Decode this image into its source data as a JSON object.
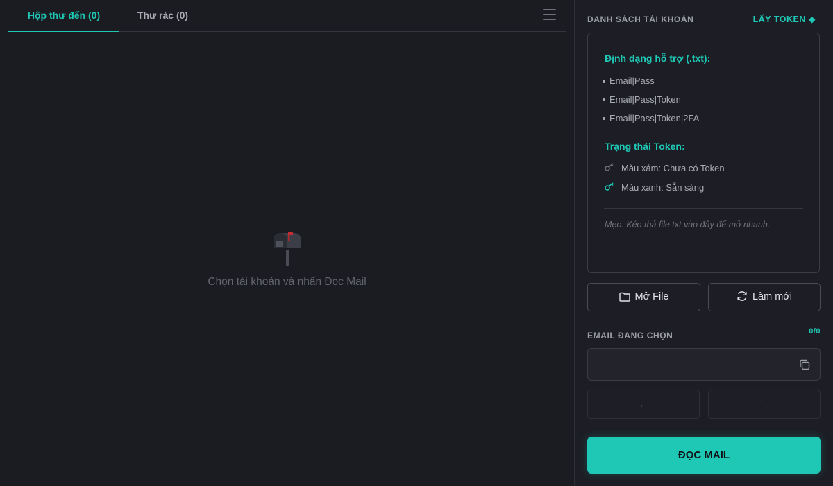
{
  "tabs": [
    {
      "label": "Hộp thư đến (0)",
      "active": true
    },
    {
      "label": "Thư rác (0)",
      "active": false
    }
  ],
  "empty_state": {
    "icon": "mailbox-icon",
    "text": "Chọn tài khoản và nhấn Đọc Mail"
  },
  "sidebar": {
    "account_list_title": "DANH SÁCH TÀI KHOẢN",
    "get_token_label": "LẤY TOKEN ◆",
    "info": {
      "formats_title": "Định dạng hỗ trợ (.txt):",
      "formats": [
        "Email|Pass",
        "Email|Pass|Token",
        "Email|Pass|Token|2FA"
      ],
      "token_status_title": "Trạng thái Token:",
      "token_gray": "Màu xám: Chưa có Token",
      "token_green": "Màu xanh: Sẵn sàng",
      "tip": "Mẹo: Kéo thả file txt vào đây để mở nhanh."
    },
    "open_file_label": "Mở File",
    "refresh_label": "Làm mới",
    "selected_email_title": "EMAIL ĐANG CHỌN",
    "count": "0/0",
    "email_value": "",
    "prev_label": "←",
    "next_label": "→",
    "read_mail_label": "ĐỌC MAIL"
  },
  "colors": {
    "accent": "#1ec8b4",
    "background": "#1b1c22",
    "panel": "#1d1e25",
    "key_gray": "#6f727b"
  }
}
